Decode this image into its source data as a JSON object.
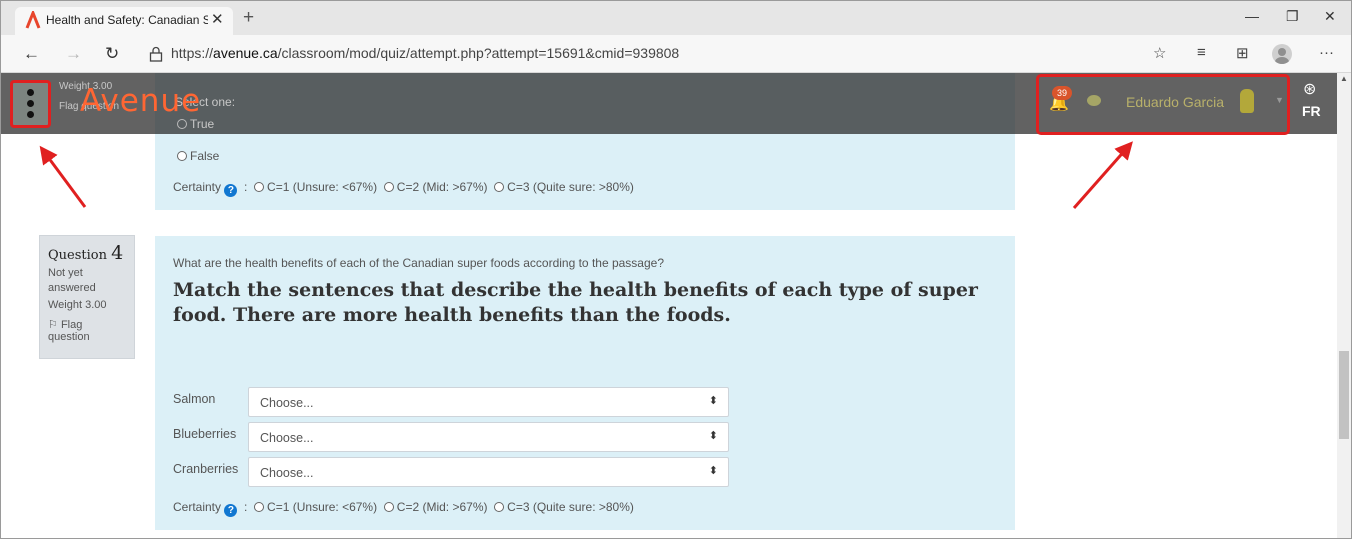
{
  "browser": {
    "tab_title": "Health and Safety: Canadian Sup",
    "tab_close": "✕",
    "new_tab": "+",
    "url_prefix": "https://",
    "url_domain": "avenue.ca",
    "url_path": "/classroom/mod/quiz/attempt.php?attempt=15691&cmid=939808",
    "minimize": "—",
    "restore": "❐",
    "close": "✕",
    "icons": [
      "star-add-icon",
      "favorites-icon",
      "collections-icon",
      "profile-icon",
      "more-icon"
    ],
    "more": "···"
  },
  "header": {
    "brand": "Avenue",
    "notification_count": "39",
    "user_name": "Eduardo Garcia",
    "language": "FR",
    "under_text": {
      "weight": "Weight 3.00",
      "flag": "Flag question",
      "select_one": "Select one:"
    }
  },
  "question3": {
    "options": [
      "True",
      "False"
    ],
    "certainty_label": "Certainty",
    "certainty_options": [
      "C=1 (Unsure: <67%)",
      "C=2 (Mid: >67%)",
      "C=3 (Quite sure: >80%)"
    ]
  },
  "question4": {
    "info_label": "Question",
    "number": "4",
    "status": "Not yet answered",
    "weight": "Weight 3.00",
    "flag": "Flag question",
    "prompt": "What are the health benefits of each of the Canadian super foods according to the passage?",
    "heading": "Match the sentences that describe the health benefits of each type of super food. There are more health benefits than the foods.",
    "items": [
      {
        "label": "Salmon",
        "value": "Choose..."
      },
      {
        "label": "Blueberries",
        "value": "Choose..."
      },
      {
        "label": "Cranberries",
        "value": "Choose..."
      }
    ],
    "certainty_label": "Certainty",
    "certainty_options": [
      "C=1 (Unsure: <67%)",
      "C=2 (Mid: >67%)",
      "C=3 (Quite sure: >80%)"
    ]
  },
  "colors": {
    "brand": "#ff6633",
    "question_bg": "#dcf0f7",
    "annotation": "#e02020",
    "help": "#1177d1"
  }
}
